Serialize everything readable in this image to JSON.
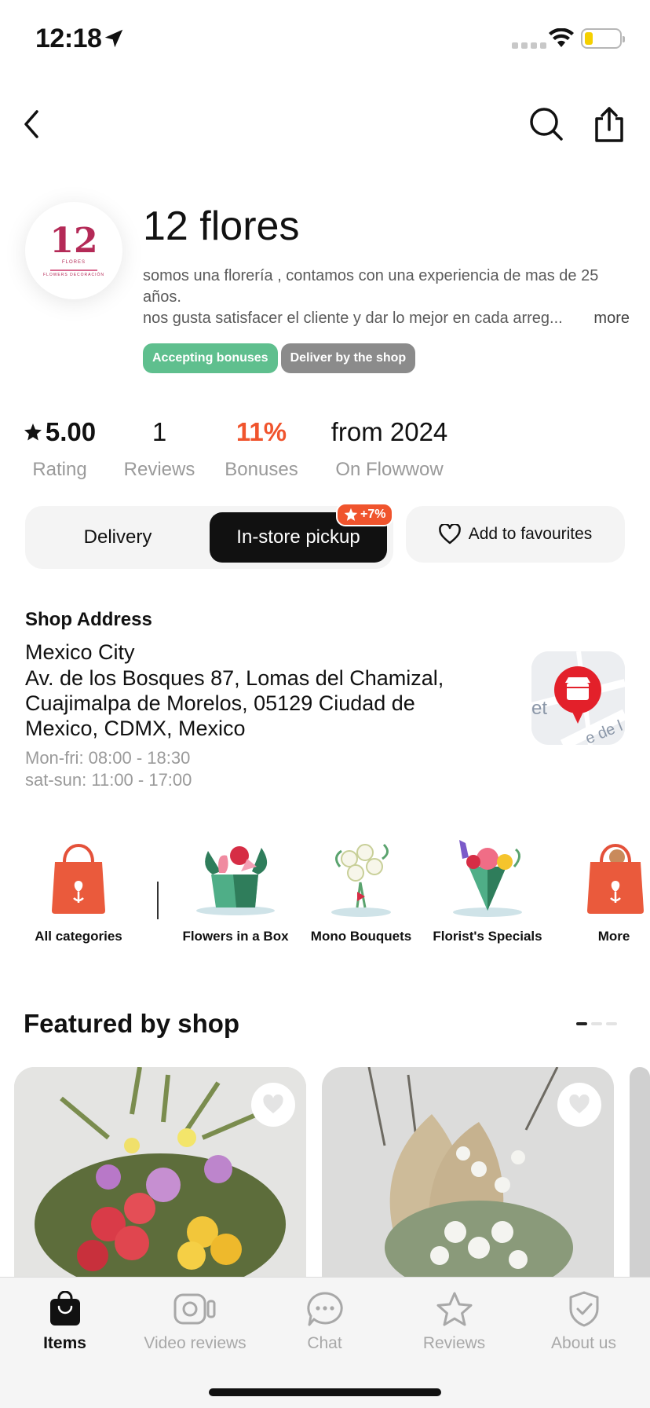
{
  "status_bar": {
    "time": "12:18",
    "battery_level": 0.2
  },
  "nav": {
    "back_icon": "chevron-left-icon",
    "search_icon": "search-icon",
    "share_icon": "share-icon"
  },
  "shop": {
    "logo_text": "12",
    "logo_sub": "FLORES",
    "logo_sub2": "FLOWERS DECORACIÓN",
    "name": "12 flores",
    "description_line1": "somos una florería , contamos con una experiencia de mas de 25 años.",
    "description_line2": "nos gusta satisfacer el cliente y dar lo mejor en cada arreg...",
    "more_label": "more",
    "badges": [
      "Accepting bonuses",
      "Deliver by the shop"
    ]
  },
  "stats": {
    "rating": {
      "value": "5.00",
      "label": "Rating"
    },
    "reviews": {
      "value": "1",
      "label": "Reviews"
    },
    "bonuses": {
      "value": "11%",
      "label": "Bonuses"
    },
    "since": {
      "value": "from 2024",
      "label": "On Flowwow"
    }
  },
  "delivery_toggle": {
    "delivery_label": "Delivery",
    "pickup_label": "In-store pickup",
    "pickup_badge": "+7%",
    "selected": "In-store pickup"
  },
  "favourites_label": "Add to favourites",
  "address": {
    "title": "Shop Address",
    "city": "Mexico City",
    "street": "Av. de los Bosques 87, Lomas del Chamizal, Cuajimalpa de Morelos, 05129 Ciudad de Mexico, CDMX, Mexico",
    "hours_weekday": "Mon-fri: 08:00 - 18:30",
    "hours_weekend": "sat-sun: 11:00 - 17:00",
    "map_text_1": "et",
    "map_text_2": "e de l"
  },
  "categories": [
    {
      "label": "All categories",
      "icon": "tote-bag-icon"
    },
    {
      "label": "Flowers in a Box",
      "icon": "flower-box-icon"
    },
    {
      "label": "Mono Bouquets",
      "icon": "white-bouquet-icon"
    },
    {
      "label": "Florist's Specials",
      "icon": "mixed-bouquet-icon"
    },
    {
      "label": "More",
      "icon": "gift-bag-icon"
    }
  ],
  "featured": {
    "title": "Featured by shop",
    "page_count": 3,
    "active_page": 1
  },
  "tabbar": {
    "items": [
      {
        "label": "Items",
        "icon": "shopping-bag-icon",
        "active": true
      },
      {
        "label": "Video reviews",
        "icon": "video-camera-icon",
        "active": false
      },
      {
        "label": "Chat",
        "icon": "chat-bubble-icon",
        "active": false
      },
      {
        "label": "Reviews",
        "icon": "star-icon",
        "active": false
      },
      {
        "label": "About us",
        "icon": "shield-check-icon",
        "active": false
      }
    ]
  },
  "colors": {
    "accent_orange": "#f0542d",
    "badge_green": "#5fbf8e",
    "badge_gray": "#8b8b8b",
    "logo_magenta": "#b42a57"
  }
}
